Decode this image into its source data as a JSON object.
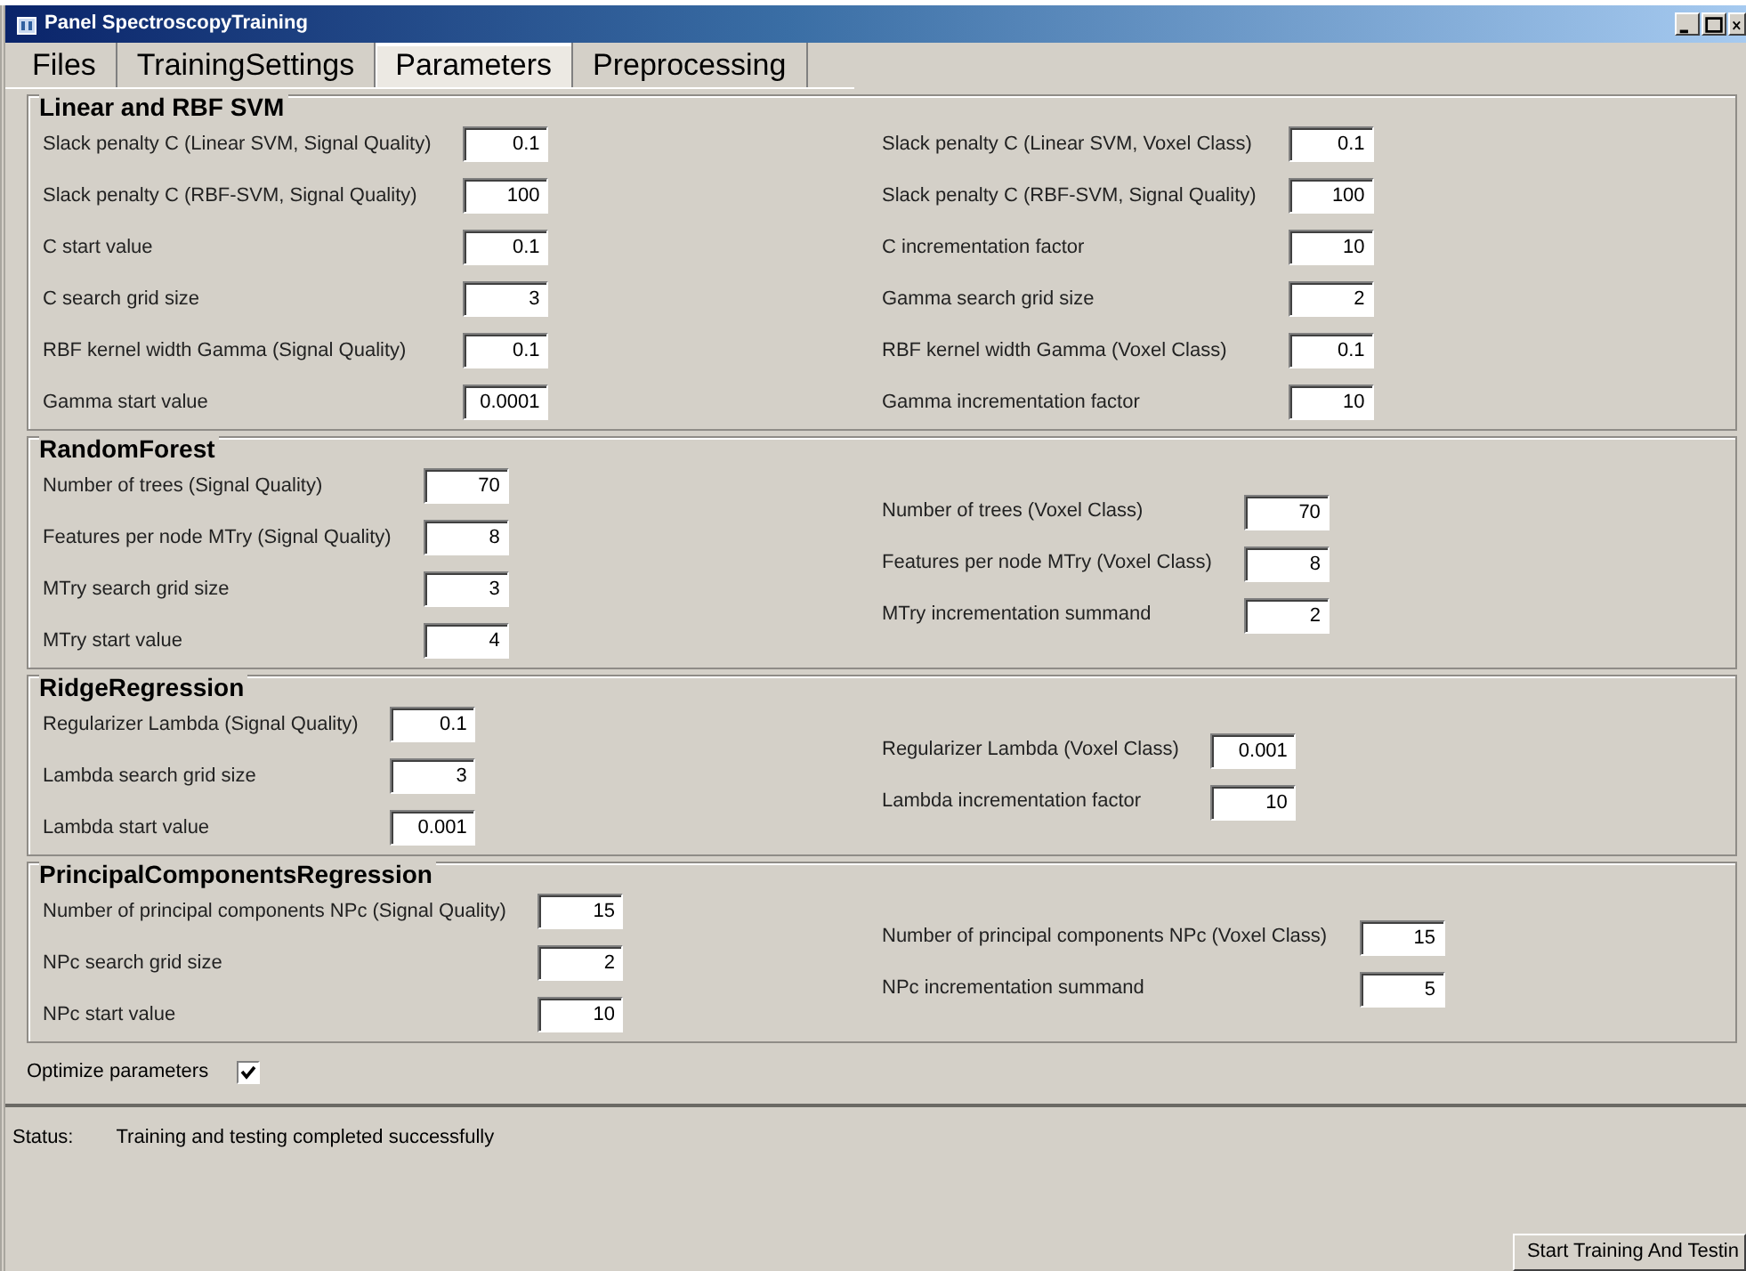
{
  "window": {
    "title": "Panel SpectroscopyTraining"
  },
  "tabs": [
    {
      "label": "Files",
      "selected": false
    },
    {
      "label": "TrainingSettings",
      "selected": false
    },
    {
      "label": "Parameters",
      "selected": true
    },
    {
      "label": "Preprocessing",
      "selected": false
    }
  ],
  "groups": [
    {
      "title": "Linear and RBF SVM",
      "left": [
        {
          "label": "Slack penalty C (Linear SVM, Signal Quality)",
          "value": "0.1"
        },
        {
          "label": "Slack penalty C (RBF-SVM, Signal Quality)",
          "value": "100"
        },
        {
          "label": "C start value",
          "value": "0.1"
        },
        {
          "label": "C search grid size",
          "value": "3"
        },
        {
          "label": "RBF kernel width Gamma (Signal Quality)",
          "value": "0.1"
        },
        {
          "label": "Gamma start value",
          "value": "0.0001"
        }
      ],
      "right": [
        {
          "label": "Slack penalty C (Linear SVM, Voxel Class)",
          "value": "0.1"
        },
        {
          "label": "Slack penalty C (RBF-SVM, Signal Quality)",
          "value": "100"
        },
        {
          "label": "C incrementation factor",
          "value": "10"
        },
        {
          "label": "Gamma search grid size",
          "value": "2"
        },
        {
          "label": "RBF kernel width Gamma (Voxel Class)",
          "value": "0.1"
        },
        {
          "label": "Gamma incrementation factor",
          "value": "10"
        }
      ]
    },
    {
      "title": "RandomForest",
      "left": [
        {
          "label": "Number of trees (Signal Quality)",
          "value": "70"
        },
        {
          "label": "Features per node MTry (Signal Quality)",
          "value": "8"
        },
        {
          "label": "MTry search grid size",
          "value": "3"
        },
        {
          "label": "MTry start value",
          "value": "4"
        }
      ],
      "right": [
        {
          "label": "Number of trees (Voxel Class)",
          "value": "70"
        },
        {
          "label": "Features per node MTry (Voxel Class)",
          "value": "8"
        },
        {
          "label": "MTry incrementation summand",
          "value": "2"
        }
      ]
    },
    {
      "title": "RidgeRegression",
      "left": [
        {
          "label": "Regularizer Lambda (Signal Quality)",
          "value": "0.1"
        },
        {
          "label": "Lambda search grid size",
          "value": "3"
        },
        {
          "label": "Lambda start value",
          "value": "0.001"
        }
      ],
      "right": [
        {
          "label": "Regularizer Lambda (Voxel Class)",
          "value": "0.001"
        },
        {
          "label": "Lambda incrementation factor",
          "value": "10"
        }
      ]
    },
    {
      "title": "PrincipalComponentsRegression",
      "left": [
        {
          "label": "Number of principal components NPc (Signal Quality)",
          "value": "15"
        },
        {
          "label": "NPc search grid size",
          "value": "2"
        },
        {
          "label": "NPc start value",
          "value": "10"
        }
      ],
      "right": [
        {
          "label": "Number of principal components NPc (Voxel Class)",
          "value": "15"
        },
        {
          "label": "NPc incrementation summand",
          "value": "5"
        }
      ]
    }
  ],
  "optimize": {
    "label": "Optimize parameters",
    "checked": true
  },
  "status": {
    "label": "Status:",
    "text": "Training and testing completed successfully"
  },
  "buttons": [
    "Start Training And Testin"
  ]
}
